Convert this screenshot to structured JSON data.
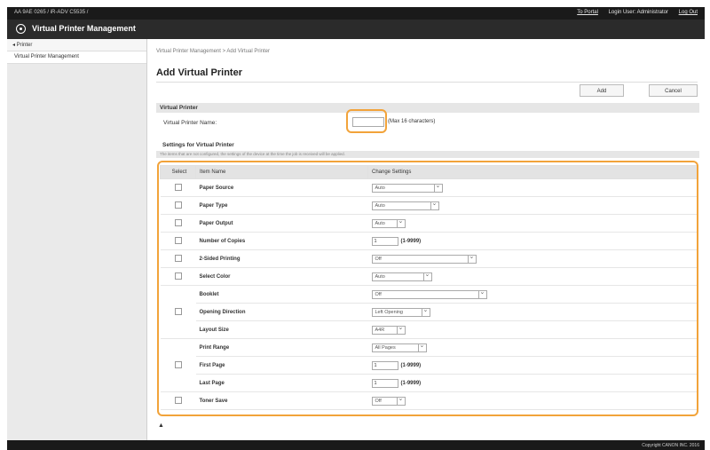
{
  "header": {
    "path": "AA 9AE 0265 / iR-ADV C5535 /",
    "to_portal": "To Portal",
    "login_user": "Login User: Administrator",
    "logout": "Log Out",
    "app_title": "Virtual Printer Management"
  },
  "sidebar": {
    "top": "◂ Printer",
    "items": [
      {
        "label": "Virtual Printer Management"
      }
    ]
  },
  "main": {
    "breadcrumb": "Virtual Printer Management > Add Virtual Printer",
    "title": "Add Virtual Printer",
    "buttons": {
      "add": "Add",
      "cancel": "Cancel"
    },
    "vp_section": "Virtual Printer",
    "vp_name_label": "Virtual Printer Name:",
    "vp_name_value": "",
    "vp_name_hint": "(Max 16 characters)",
    "settings_section": "Settings for Virtual Printer",
    "settings_note": "The items that are not configured, the settings of the device at the time the job is received will be applied.",
    "table": {
      "headers": {
        "select": "Select",
        "item": "Item Name",
        "change": "Change Settings"
      },
      "rows": [
        {
          "name": "Paper Source",
          "value": "Auto"
        },
        {
          "name": "Paper Type",
          "value": "Auto"
        },
        {
          "name": "Paper Output",
          "value": "Auto"
        },
        {
          "name": "Number of Copies",
          "value": "1",
          "range": "(1-9999)"
        },
        {
          "name": "2-Sided Printing",
          "value": "Off"
        },
        {
          "name": "Select Color",
          "value": "Auto"
        },
        {
          "name": "Booklet",
          "value": "Off"
        },
        {
          "name": "Opening Direction",
          "value": "Left Opening"
        },
        {
          "name": "Layout Size",
          "value": "A4R"
        },
        {
          "name": "Print Range",
          "value": "All Pages"
        },
        {
          "name": "First Page",
          "value": "1",
          "range": "(1-9999)"
        },
        {
          "name": "Last Page",
          "value": "1",
          "range": "(1-9999)"
        },
        {
          "name": "Toner Save",
          "value": "Off"
        }
      ]
    },
    "top_arrow": "▲"
  },
  "footer": {
    "copyright": "Copyright CANON INC. 2016"
  },
  "colors": {
    "highlight": "#f2a33a",
    "header_bg": "#2b2b2b"
  }
}
